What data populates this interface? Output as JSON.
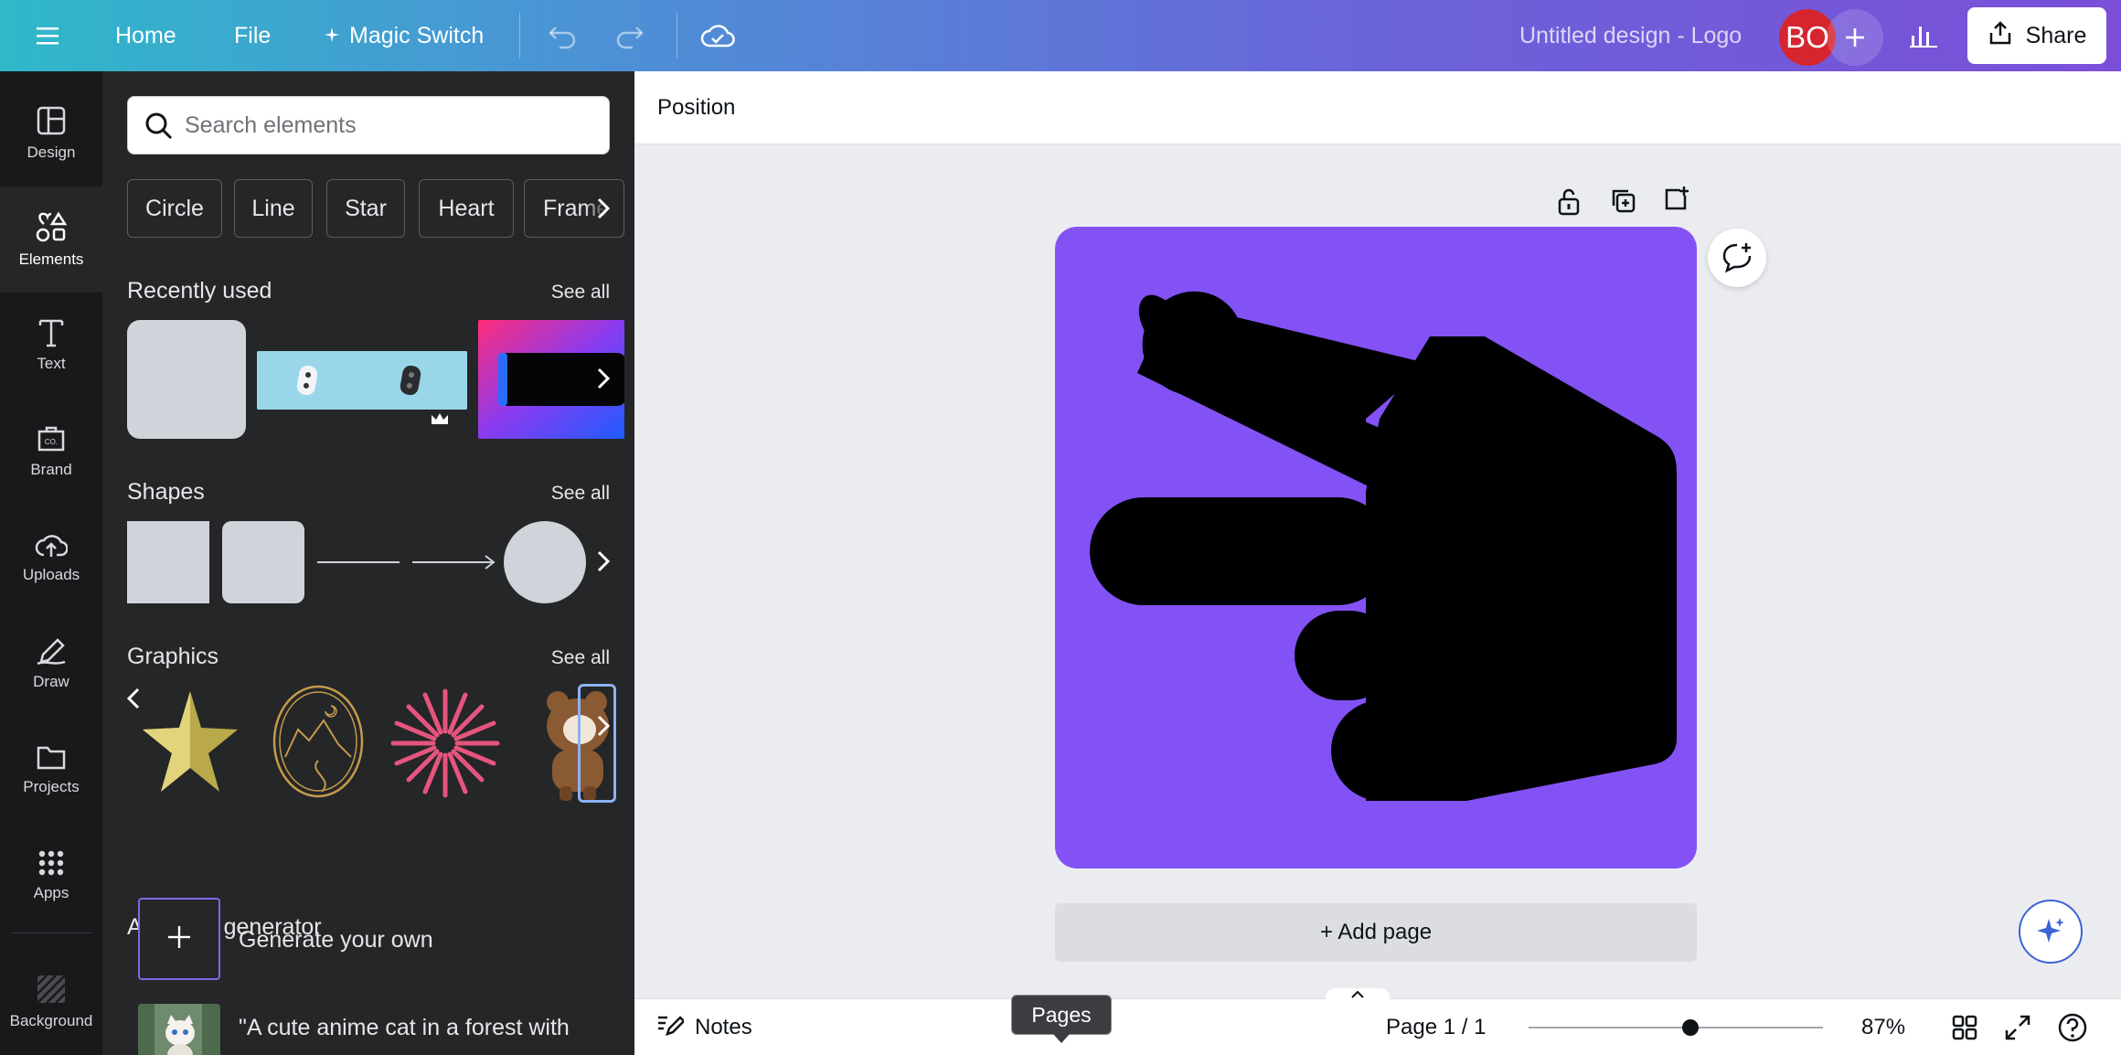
{
  "topbar": {
    "home": "Home",
    "file": "File",
    "magic_switch": "Magic Switch",
    "design_title": "Untitled design - Logo",
    "avatar_initials": "BO",
    "share": "Share"
  },
  "rail": {
    "design": "Design",
    "elements": "Elements",
    "text": "Text",
    "brand": "Brand",
    "uploads": "Uploads",
    "draw": "Draw",
    "projects": "Projects",
    "apps": "Apps",
    "background": "Background"
  },
  "panel": {
    "search_placeholder": "Search elements",
    "chips": [
      "Circle",
      "Line",
      "Star",
      "Heart",
      "Frame"
    ],
    "recently_used": "Recently used",
    "shapes": "Shapes",
    "graphics": "Graphics",
    "see_all": "See all",
    "ai_title": "AI image generator",
    "generate_own": "Generate your own",
    "ai_prompt": "\"A cute anime cat in a forest with"
  },
  "toolbar": {
    "position": "Position"
  },
  "canvas": {
    "page_color": "#8352f5",
    "add_page": "+ Add page"
  },
  "bottom": {
    "notes": "Notes",
    "pages_tooltip": "Pages",
    "page_indicator": "Page 1 / 1",
    "zoom": "87%",
    "zoom_level": 0.55
  },
  "colors": {
    "accent": "#8352f5",
    "panel_bg": "#252627",
    "rail_bg": "#18191b",
    "avatar": "#d5262f"
  }
}
